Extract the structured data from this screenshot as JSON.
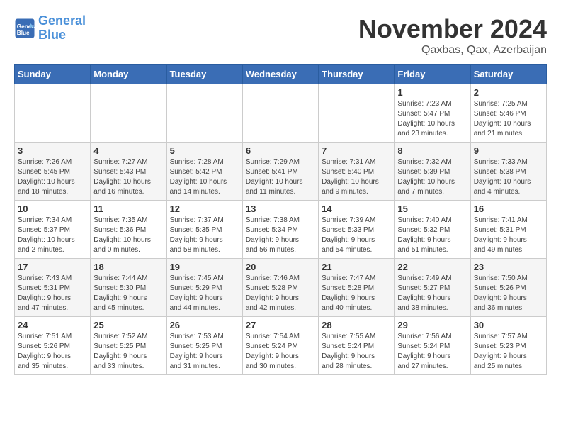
{
  "header": {
    "logo_line1": "General",
    "logo_line2": "Blue",
    "month_title": "November 2024",
    "location": "Qaxbas, Qax, Azerbaijan"
  },
  "days_of_week": [
    "Sunday",
    "Monday",
    "Tuesday",
    "Wednesday",
    "Thursday",
    "Friday",
    "Saturday"
  ],
  "weeks": [
    [
      {
        "day": "",
        "info": ""
      },
      {
        "day": "",
        "info": ""
      },
      {
        "day": "",
        "info": ""
      },
      {
        "day": "",
        "info": ""
      },
      {
        "day": "",
        "info": ""
      },
      {
        "day": "1",
        "info": "Sunrise: 7:23 AM\nSunset: 5:47 PM\nDaylight: 10 hours\nand 23 minutes."
      },
      {
        "day": "2",
        "info": "Sunrise: 7:25 AM\nSunset: 5:46 PM\nDaylight: 10 hours\nand 21 minutes."
      }
    ],
    [
      {
        "day": "3",
        "info": "Sunrise: 7:26 AM\nSunset: 5:45 PM\nDaylight: 10 hours\nand 18 minutes."
      },
      {
        "day": "4",
        "info": "Sunrise: 7:27 AM\nSunset: 5:43 PM\nDaylight: 10 hours\nand 16 minutes."
      },
      {
        "day": "5",
        "info": "Sunrise: 7:28 AM\nSunset: 5:42 PM\nDaylight: 10 hours\nand 14 minutes."
      },
      {
        "day": "6",
        "info": "Sunrise: 7:29 AM\nSunset: 5:41 PM\nDaylight: 10 hours\nand 11 minutes."
      },
      {
        "day": "7",
        "info": "Sunrise: 7:31 AM\nSunset: 5:40 PM\nDaylight: 10 hours\nand 9 minutes."
      },
      {
        "day": "8",
        "info": "Sunrise: 7:32 AM\nSunset: 5:39 PM\nDaylight: 10 hours\nand 7 minutes."
      },
      {
        "day": "9",
        "info": "Sunrise: 7:33 AM\nSunset: 5:38 PM\nDaylight: 10 hours\nand 4 minutes."
      }
    ],
    [
      {
        "day": "10",
        "info": "Sunrise: 7:34 AM\nSunset: 5:37 PM\nDaylight: 10 hours\nand 2 minutes."
      },
      {
        "day": "11",
        "info": "Sunrise: 7:35 AM\nSunset: 5:36 PM\nDaylight: 10 hours\nand 0 minutes."
      },
      {
        "day": "12",
        "info": "Sunrise: 7:37 AM\nSunset: 5:35 PM\nDaylight: 9 hours\nand 58 minutes."
      },
      {
        "day": "13",
        "info": "Sunrise: 7:38 AM\nSunset: 5:34 PM\nDaylight: 9 hours\nand 56 minutes."
      },
      {
        "day": "14",
        "info": "Sunrise: 7:39 AM\nSunset: 5:33 PM\nDaylight: 9 hours\nand 54 minutes."
      },
      {
        "day": "15",
        "info": "Sunrise: 7:40 AM\nSunset: 5:32 PM\nDaylight: 9 hours\nand 51 minutes."
      },
      {
        "day": "16",
        "info": "Sunrise: 7:41 AM\nSunset: 5:31 PM\nDaylight: 9 hours\nand 49 minutes."
      }
    ],
    [
      {
        "day": "17",
        "info": "Sunrise: 7:43 AM\nSunset: 5:31 PM\nDaylight: 9 hours\nand 47 minutes."
      },
      {
        "day": "18",
        "info": "Sunrise: 7:44 AM\nSunset: 5:30 PM\nDaylight: 9 hours\nand 45 minutes."
      },
      {
        "day": "19",
        "info": "Sunrise: 7:45 AM\nSunset: 5:29 PM\nDaylight: 9 hours\nand 44 minutes."
      },
      {
        "day": "20",
        "info": "Sunrise: 7:46 AM\nSunset: 5:28 PM\nDaylight: 9 hours\nand 42 minutes."
      },
      {
        "day": "21",
        "info": "Sunrise: 7:47 AM\nSunset: 5:28 PM\nDaylight: 9 hours\nand 40 minutes."
      },
      {
        "day": "22",
        "info": "Sunrise: 7:49 AM\nSunset: 5:27 PM\nDaylight: 9 hours\nand 38 minutes."
      },
      {
        "day": "23",
        "info": "Sunrise: 7:50 AM\nSunset: 5:26 PM\nDaylight: 9 hours\nand 36 minutes."
      }
    ],
    [
      {
        "day": "24",
        "info": "Sunrise: 7:51 AM\nSunset: 5:26 PM\nDaylight: 9 hours\nand 35 minutes."
      },
      {
        "day": "25",
        "info": "Sunrise: 7:52 AM\nSunset: 5:25 PM\nDaylight: 9 hours\nand 33 minutes."
      },
      {
        "day": "26",
        "info": "Sunrise: 7:53 AM\nSunset: 5:25 PM\nDaylight: 9 hours\nand 31 minutes."
      },
      {
        "day": "27",
        "info": "Sunrise: 7:54 AM\nSunset: 5:24 PM\nDaylight: 9 hours\nand 30 minutes."
      },
      {
        "day": "28",
        "info": "Sunrise: 7:55 AM\nSunset: 5:24 PM\nDaylight: 9 hours\nand 28 minutes."
      },
      {
        "day": "29",
        "info": "Sunrise: 7:56 AM\nSunset: 5:24 PM\nDaylight: 9 hours\nand 27 minutes."
      },
      {
        "day": "30",
        "info": "Sunrise: 7:57 AM\nSunset: 5:23 PM\nDaylight: 9 hours\nand 25 minutes."
      }
    ]
  ]
}
